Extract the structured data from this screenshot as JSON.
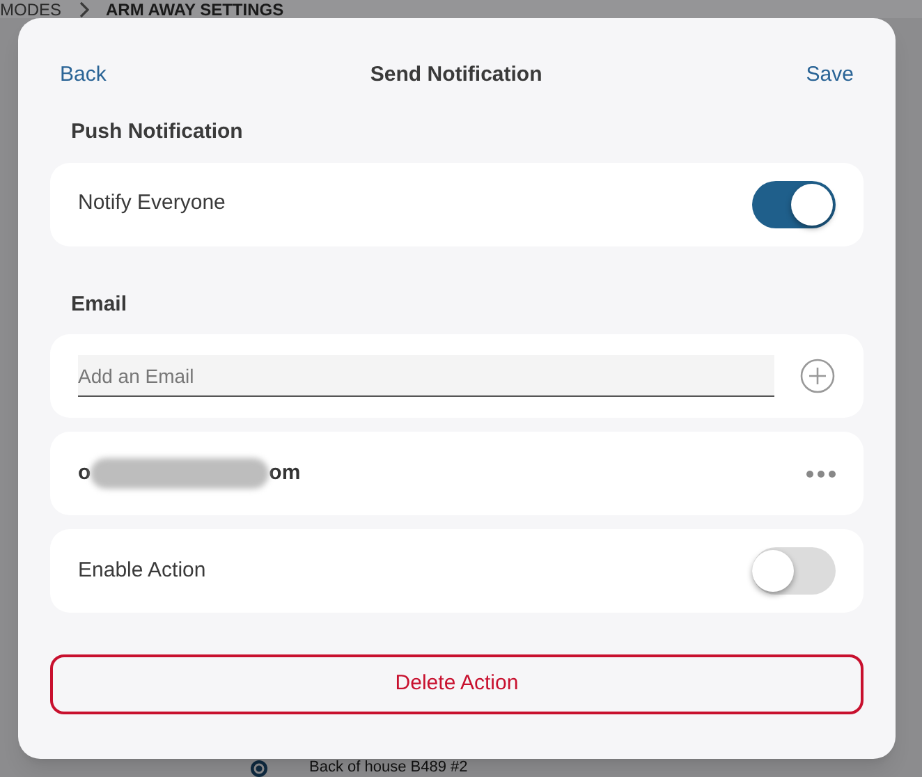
{
  "background": {
    "breadcrumb": [
      "MODES",
      "ARM AWAY SETTINGS"
    ],
    "list_item": "Back of house B489 #2"
  },
  "dialog": {
    "back": "Back",
    "title": "Send Notification",
    "save": "Save",
    "push": {
      "heading": "Push Notification",
      "label": "Notify Everyone",
      "on": true
    },
    "email": {
      "heading": "Email",
      "placeholder": "Add an Email",
      "entries": [
        {
          "visible_start": "o",
          "visible_end": "om"
        }
      ]
    },
    "enable": {
      "label": "Enable Action",
      "on": false
    },
    "delete": "Delete Action"
  }
}
